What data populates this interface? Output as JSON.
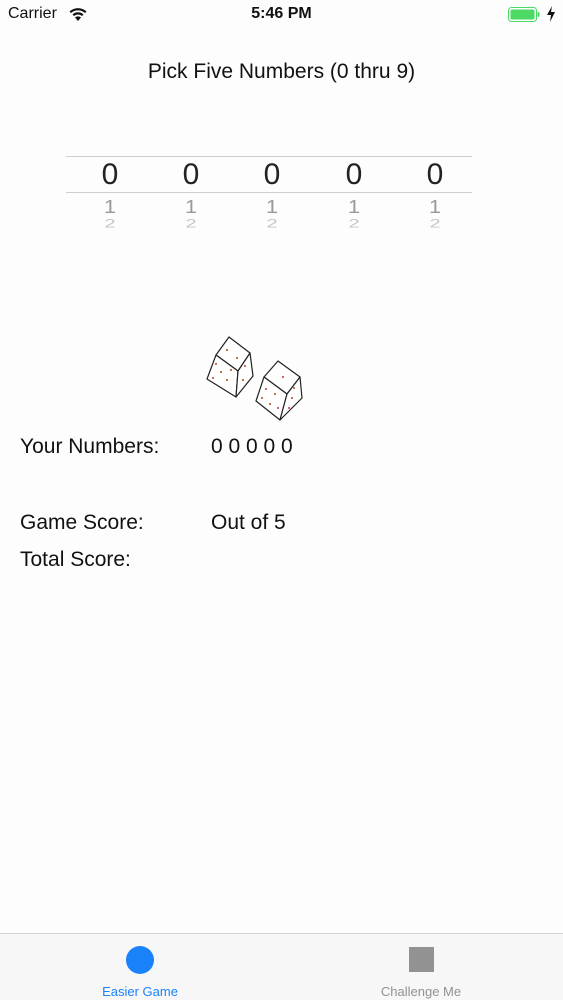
{
  "status_bar": {
    "carrier": "Carrier",
    "time": "5:46 PM",
    "wifi_icon": "wifi-icon",
    "battery_icon": "battery-icon",
    "charging_icon": "charging-bolt-icon",
    "battery_color": "#4cd964"
  },
  "title": "Pick Five Numbers (0 thru 9)",
  "picker": {
    "columns": [
      {
        "selected": "0",
        "next": "1",
        "next2": "2"
      },
      {
        "selected": "0",
        "next": "1",
        "next2": "2"
      },
      {
        "selected": "0",
        "next": "1",
        "next2": "2"
      },
      {
        "selected": "0",
        "next": "1",
        "next2": "2"
      },
      {
        "selected": "0",
        "next": "1",
        "next2": "2"
      }
    ]
  },
  "dice_icon": "dice-icon",
  "info": {
    "your_numbers_label": "Your Numbers:",
    "your_numbers_value": "0 0 0 0 0",
    "game_score_label": "Game Score:",
    "game_score_value": "Out of 5",
    "total_score_label": "Total Score:"
  },
  "tab_bar": {
    "tabs": [
      {
        "label": "Easier Game",
        "icon": "circle-icon",
        "active": true
      },
      {
        "label": "Challenge Me",
        "icon": "square-icon",
        "active": false
      }
    ],
    "accent_color": "#1a82fb",
    "inactive_color": "#929292"
  }
}
